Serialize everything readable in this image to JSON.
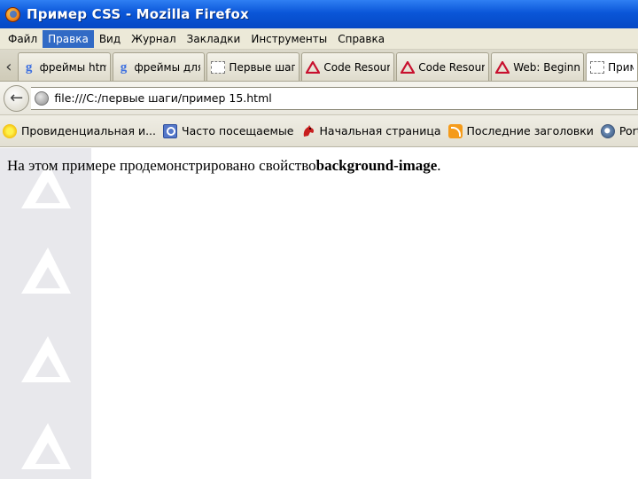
{
  "window": {
    "title": "Пример CSS - Mozilla Firefox"
  },
  "menu": {
    "items": [
      {
        "label": "Файл"
      },
      {
        "label": "Правка"
      },
      {
        "label": "Вид"
      },
      {
        "label": "Журнал"
      },
      {
        "label": "Закладки"
      },
      {
        "label": "Инструменты"
      },
      {
        "label": "Справка"
      }
    ],
    "active_index": 1
  },
  "tabs": {
    "scroll_left_glyph": "‹",
    "items": [
      {
        "label": "фреймы html...",
        "icon": "google-g-icon"
      },
      {
        "label": "фреймы для...",
        "icon": "google-g-icon"
      },
      {
        "label": "Первые шаг...",
        "icon": "blank-page-icon"
      },
      {
        "label": "Code Resour...",
        "icon": "red-triangle-icon"
      },
      {
        "label": "Code Resour...",
        "icon": "red-triangle-icon"
      },
      {
        "label": "Web: Beginni...",
        "icon": "red-triangle-icon"
      },
      {
        "label": "Приме",
        "icon": "blank-page-icon"
      }
    ]
  },
  "navbar": {
    "back_glyph": "←",
    "url": "file:///C:/первые шаги/пример 15.html"
  },
  "bookmarks": {
    "items": [
      {
        "label": "Провиденциальная и...",
        "icon": "sun-icon"
      },
      {
        "label": "Часто посещаемые",
        "icon": "search-icon"
      },
      {
        "label": "Начальная страница",
        "icon": "red-fox-icon"
      },
      {
        "label": "Последние заголовки",
        "icon": "rss-icon"
      },
      {
        "label": "PortableApps.com",
        "icon": "portableapps-icon"
      }
    ]
  },
  "page": {
    "text_before": "На этом примере продемонстрировано свойство",
    "text_bold": "background-image",
    "text_after": "."
  },
  "colors": {
    "titlebar": "#0a56d8",
    "menu_active": "#316ac5",
    "tab_triangle": "#c8102e",
    "bg_strip": "#e8e8ec"
  }
}
